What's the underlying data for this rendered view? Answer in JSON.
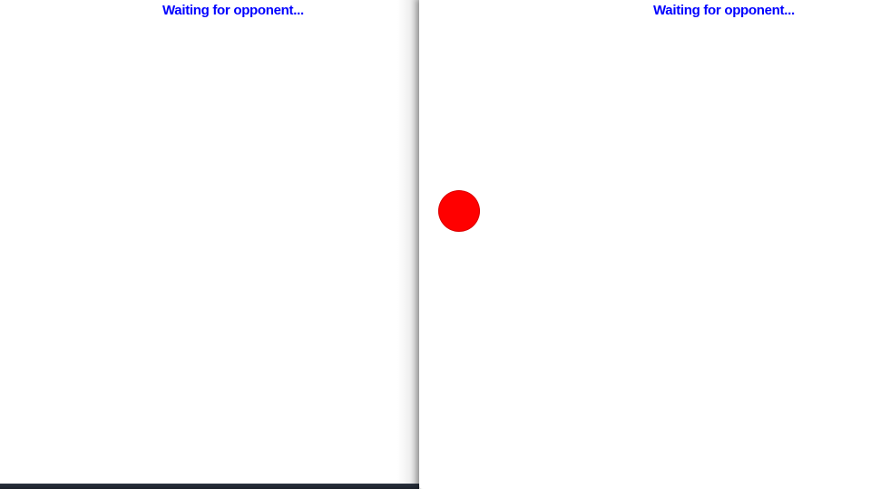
{
  "colors": {
    "status_text": "#0000ff",
    "ball": "#ff0000",
    "background": "#ffffff",
    "taskbar": "#1f2530"
  },
  "left_window": {
    "status": "Waiting for opponent..."
  },
  "right_window": {
    "status": "Waiting for opponent..."
  }
}
